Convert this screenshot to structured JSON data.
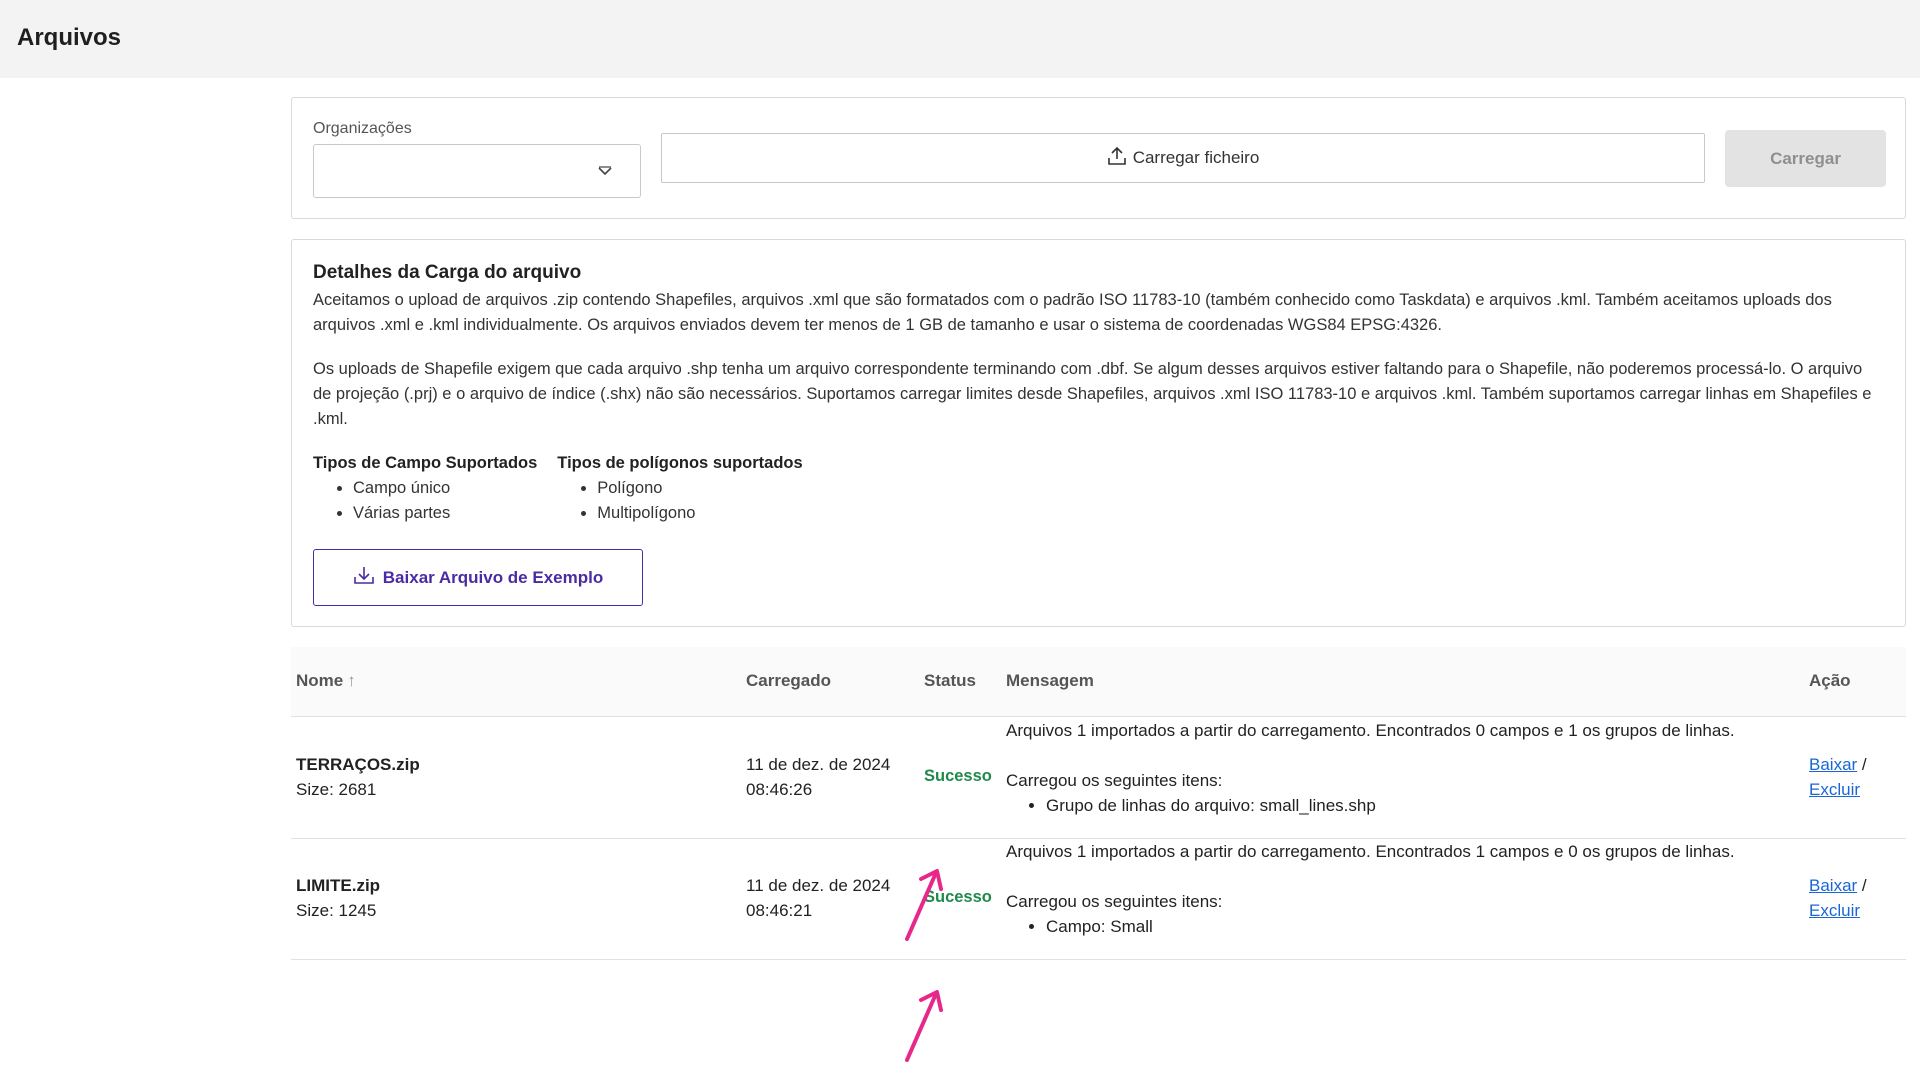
{
  "header": {
    "title": "Arquivos"
  },
  "upload": {
    "org_label": "Organizações",
    "org_value": "",
    "file_button_label": "Carregar ficheiro",
    "upload_button_label": "Carregar"
  },
  "details": {
    "title": "Detalhes da Carga do arquivo",
    "paragraph1": "Aceitamos o upload de arquivos .zip contendo Shapefiles, arquivos .xml que são formatados com o padrão ISO 11783-10 (também conhecido como Taskdata) e arquivos .kml. Também aceitamos uploads dos arquivos .xml e .kml individualmente. Os arquivos enviados devem ter menos de 1 GB de tamanho e usar o sistema de coordenadas WGS84 EPSG:4326.",
    "paragraph2": "Os uploads de Shapefile exigem que cada arquivo .shp tenha um arquivo correspondente terminando com .dbf. Se algum desses arquivos estiver faltando para o Shapefile, não poderemos processá-lo. O arquivo de projeção (.prj) e o arquivo de índice (.shx) não são necessários. Suportamos carregar limites desde Shapefiles, arquivos .xml ISO 11783-10 e arquivos .kml. Também suportamos carregar linhas em Shapefiles e .kml.",
    "field_types": {
      "title": "Tipos de Campo Suportados",
      "items": [
        "Campo único",
        "Várias partes"
      ]
    },
    "polygon_types": {
      "title": "Tipos de polígonos suportados",
      "items": [
        "Polígono",
        "Multipolígono"
      ]
    },
    "sample_button_label": "Baixar Arquivo de Exemplo"
  },
  "table": {
    "headers": {
      "name": "Nome",
      "uploaded": "Carregado",
      "status": "Status",
      "message": "Mensagem",
      "action": "Ação"
    },
    "sort_indicator": "↑",
    "rows": [
      {
        "name": "TERRAÇOS.zip",
        "size": "Size: 2681",
        "date": "11 de dez. de 2024",
        "time": "08:46:26",
        "status": "Sucesso",
        "message_summary": "Arquivos 1 importados a partir do carregamento. Encontrados 0 campos e 1 os grupos de linhas.",
        "message_intro": "Carregou os seguintes itens:",
        "message_items": [
          "Grupo de linhas do arquivo: small_lines.shp"
        ],
        "action_download": "Baixar",
        "action_separator": "/",
        "action_delete": "Excluir"
      },
      {
        "name": "LIMITE.zip",
        "size": "Size: 1245",
        "date": "11 de dez. de 2024",
        "time": "08:46:21",
        "status": "Sucesso",
        "message_summary": "Arquivos 1 importados a partir do carregamento. Encontrados 1 campos e 0 os grupos de linhas.",
        "message_intro": "Carregou os seguintes itens:",
        "message_items": [
          "Campo: Small"
        ],
        "action_download": "Baixar",
        "action_separator": "/",
        "action_delete": "Excluir"
      }
    ]
  },
  "colors": {
    "accent": "#4b2aa6",
    "success": "#1f8a4c",
    "link": "#1a66d6",
    "annotation_arrow": "#e6288a"
  },
  "icons": {
    "upload": "upload-icon",
    "download": "download-icon",
    "dropdown": "chevron-down-icon",
    "sort": "sort-arrow-up-icon"
  }
}
